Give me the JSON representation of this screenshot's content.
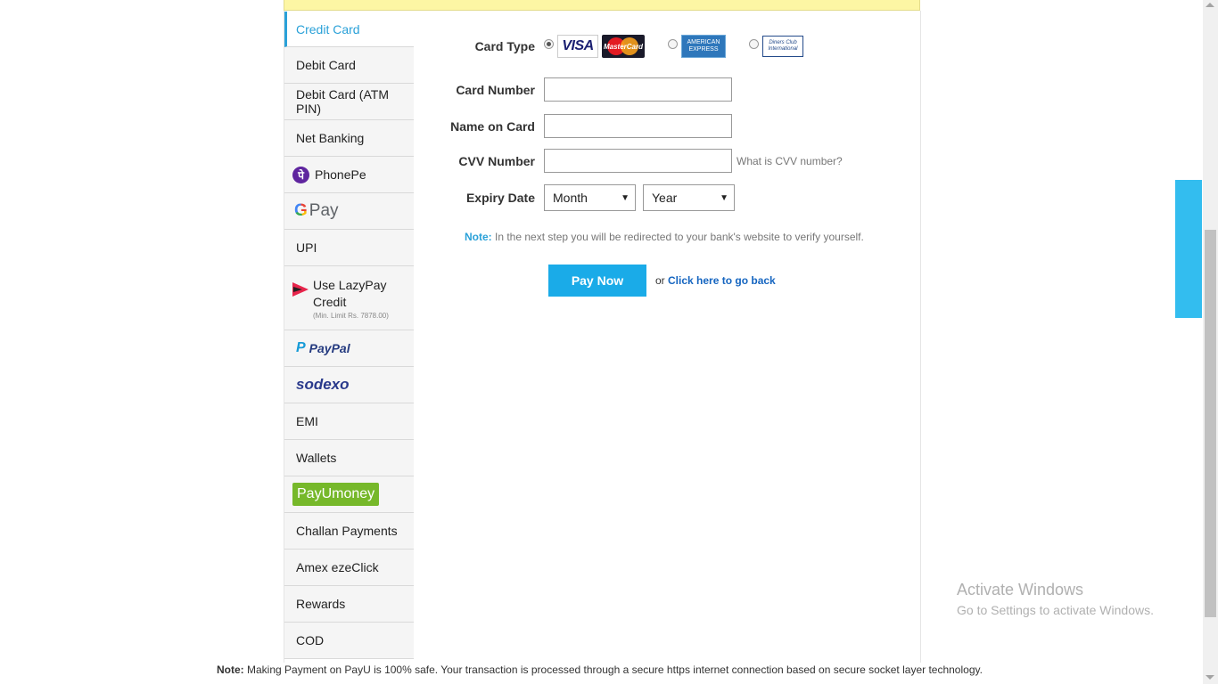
{
  "sidebar": {
    "items": [
      {
        "label": "Credit Card"
      },
      {
        "label": "Debit Card"
      },
      {
        "label": "Debit Card (ATM PIN)"
      },
      {
        "label": "Net Banking"
      },
      {
        "label": "PhonePe"
      },
      {
        "label": "Pay"
      },
      {
        "label": "UPI"
      },
      {
        "label": "Use LazyPay Credit",
        "sublabel": "(Min. Limit Rs. 7878.00)"
      },
      {
        "label": "PayPal"
      },
      {
        "label": "sodexo"
      },
      {
        "label": "EMI"
      },
      {
        "label": "Wallets"
      },
      {
        "label": "PayUmoney"
      },
      {
        "label": "Challan Payments"
      },
      {
        "label": "Amex ezeClick"
      },
      {
        "label": "Rewards"
      },
      {
        "label": "COD"
      }
    ]
  },
  "form": {
    "card_type_label": "Card Type",
    "card_number_label": "Card Number",
    "name_label": "Name on Card",
    "cvv_label": "CVV Number",
    "cvv_hint": "What is CVV number?",
    "expiry_label": "Expiry Date",
    "month_value": "Month",
    "year_value": "Year",
    "card_number_value": "",
    "name_value": "",
    "cvv_value": "",
    "cards": {
      "visa": "VISA",
      "mastercard": "MasterCard",
      "amex_line1": "AMERICAN",
      "amex_line2": "EXPRESS",
      "diners_line1": "Diners Club",
      "diners_line2": "International"
    },
    "note_keyword": "Note:",
    "note_text": " In the next step you will be redirected to your bank's website to verify yourself.",
    "pay_now": "Pay Now",
    "or_text": "or ",
    "go_back": "Click here to go back"
  },
  "footer": {
    "note_keyword": "Note:",
    "note_text": " Making Payment on PayU is 100% safe. Your transaction is processed through a secure https internet connection based on secure socket layer technology."
  },
  "watermark": {
    "line1": "Activate Windows",
    "line2": "Go to Settings to activate Windows."
  },
  "colors": {
    "accent": "#2aa1d8",
    "button": "#1aabe8",
    "banner": "#fdf6a4"
  }
}
